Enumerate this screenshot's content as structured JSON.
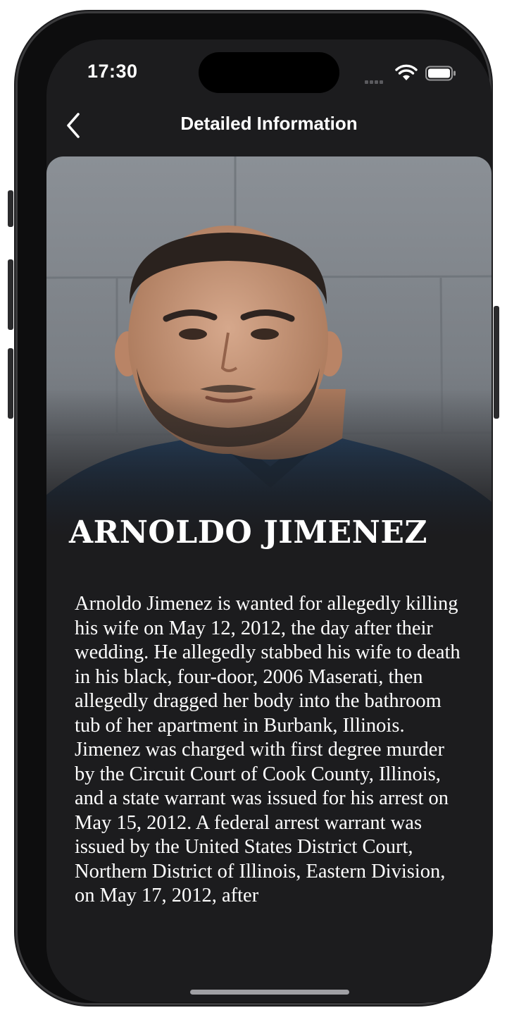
{
  "status_bar": {
    "time": "17:30"
  },
  "nav": {
    "title": "Detailed Information",
    "back_icon": "chevron-left-icon"
  },
  "profile": {
    "name": "ARNOLDO JIMENEZ",
    "photo": "mugshot-photo",
    "description": "Arnoldo Jimenez is wanted for allegedly killing his wife on May 12, 2012, the day after their wedding. He allegedly stabbed his wife to death in his black, four-door, 2006 Maserati, then allegedly dragged her body into the bathroom tub of her apartment in Burbank, Illinois. Jimenez was charged with first degree murder by the Circuit Court of Cook County, Illinois, and a state warrant was issued for his arrest on May 15, 2012. A federal arrest warrant was issued by the United States District Court, Northern District of Illinois, Eastern Division, on May 17, 2012, after"
  },
  "colors": {
    "background": "#1c1c1e",
    "text": "#ffffff",
    "wall": "#7d8288",
    "shirt": "#1f3a58"
  }
}
